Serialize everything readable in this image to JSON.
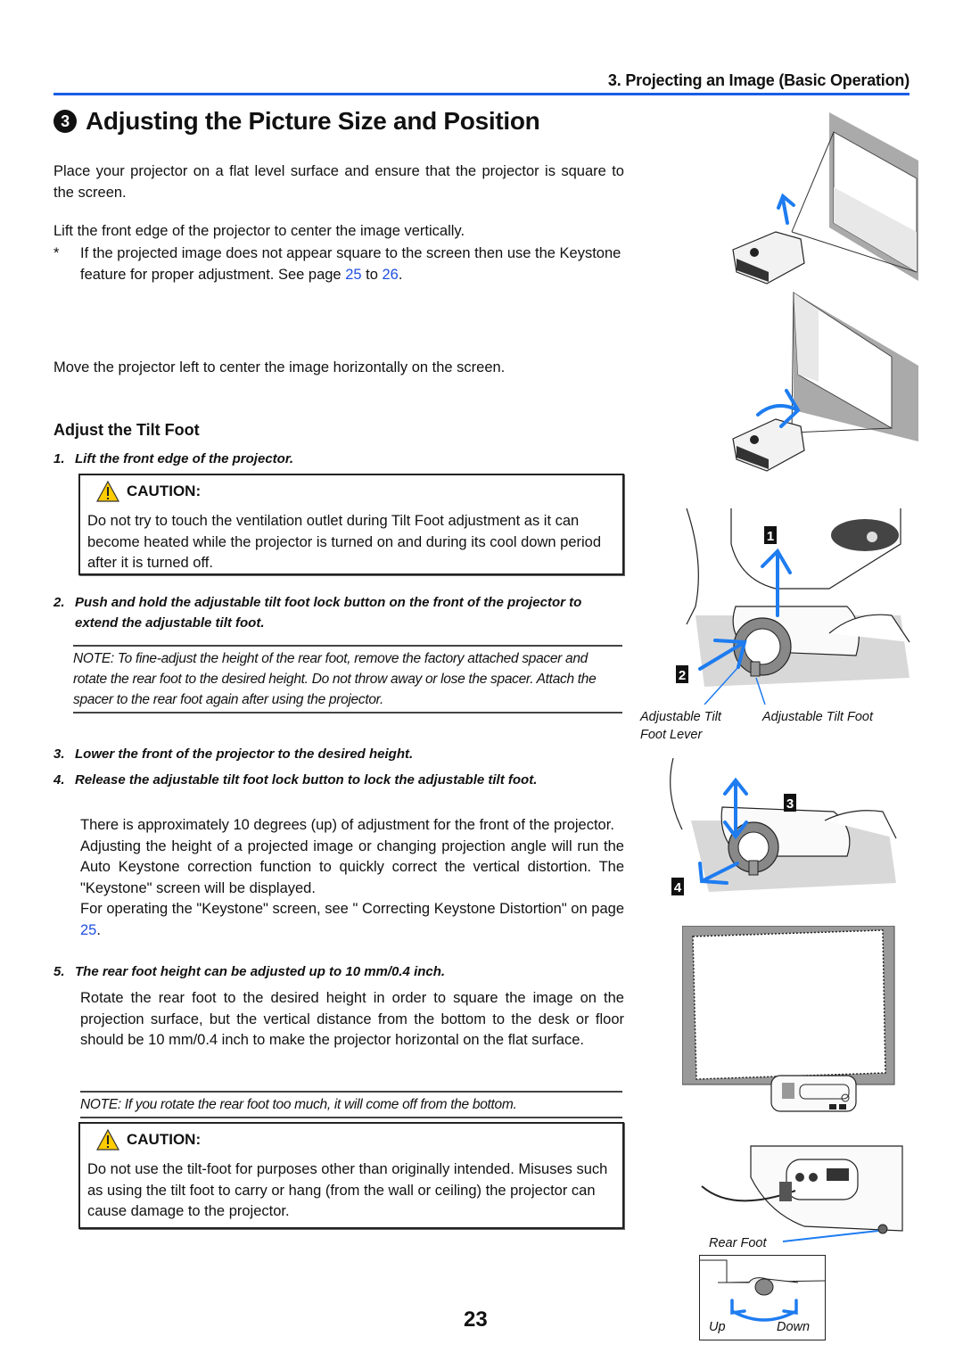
{
  "header": {
    "running_head": "3. Projecting an Image (Basic Operation)",
    "accent_color": "#1a5de8"
  },
  "section": {
    "number": "3",
    "title": "Adjusting the Picture Size and Position"
  },
  "intro": {
    "p1": "Place your projector on a flat level surface and ensure that the projector is square to the screen.",
    "p2": "Lift the front edge of the projector to center the image vertically.",
    "star_mark": "*",
    "star_text_before": "If the projected image does not appear square to the screen then use the Keystone feature for proper adjustment. See page ",
    "star_link1": "25",
    "star_mid": " to ",
    "star_link2": "26",
    "star_after": ".",
    "p3": "Move the projector left to center the image horizontally on the screen."
  },
  "tilt": {
    "heading": "Adjust the Tilt Foot",
    "steps": [
      {
        "num": "1.",
        "text": "Lift the front edge of the projector."
      },
      {
        "num": "2.",
        "text": "Push and hold the adjustable tilt foot lock button on the front of the projector to extend the adjustable tilt foot."
      },
      {
        "num": "3.",
        "text": "Lower the front of the projector to the desired height."
      },
      {
        "num": "4.",
        "text": "Release the adjustable tilt foot lock button to lock the adjustable tilt foot."
      },
      {
        "num": "5.",
        "text": "The rear foot height can be adjusted up to 10 mm/0.4 inch."
      }
    ],
    "caution1": {
      "label": "CAUTION:",
      "text": "Do not try to touch the ventilation outlet during Tilt Foot adjustment as it can become heated while the projector is turned on and during its cool down period after it is turned off."
    },
    "note1": "NOTE: To fine-adjust the height of the rear foot, remove the factory attached spacer and rotate the rear foot to the desired height. Do not throw away or lose the spacer. Attach the spacer to the rear foot again after using the projector.",
    "step4_body": {
      "l1": "There is approximately 10 degrees (up) of adjustment for the front of the projector.",
      "l2": "Adjusting the height of a projected image or changing projection angle will run the Auto Keystone correction function to quickly correct the vertical distortion. The \"Keystone\" screen will be displayed.",
      "l3_before": "For operating the \"Keystone\" screen, see \" Correcting Keystone Distortion\" on page ",
      "l3_link": "25",
      "l3_after": "."
    },
    "step5_body": "Rotate the rear foot to the desired height in order to square the image on the projection surface, but the vertical distance from the bottom to the desk or floor should be 10 mm/0.4 inch to make the projector horizontal on the flat surface.",
    "note2": "NOTE: If you rotate the rear foot too much, it will come off from the bottom.",
    "caution2": {
      "label": "CAUTION:",
      "text": "Do not use the tilt-foot for purposes other than originally intended. Misuses such as using the tilt foot to carry or hang (from the wall or ceiling) the projector can cause damage to the projector."
    }
  },
  "figures": {
    "callouts": [
      "1",
      "2",
      "3",
      "4"
    ],
    "label_lever": "Adjustable Tilt Foot Lever",
    "label_lever_l1": "Adjustable Tilt",
    "label_lever_l2": "Foot Lever",
    "label_foot": "Adjustable Tilt Foot",
    "label_rear": "Rear Foot",
    "label_up": "Up",
    "label_down": "Down",
    "arrow_color": "#1e7cf0"
  },
  "footer": {
    "page_number": "23"
  }
}
